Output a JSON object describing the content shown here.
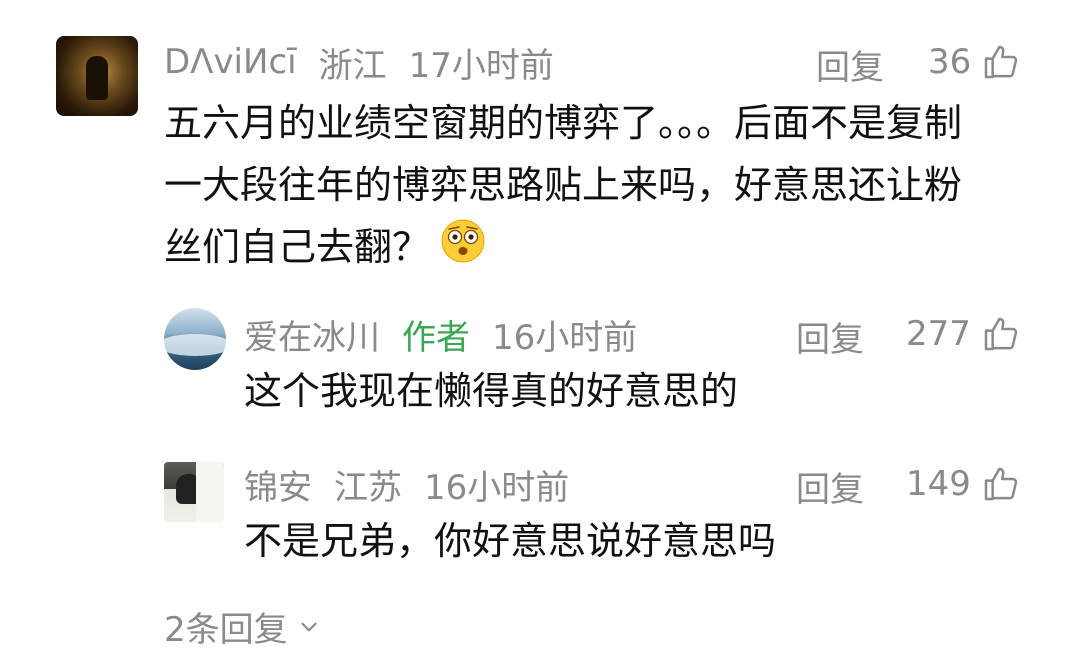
{
  "main_comment": {
    "username": "DΛviИcī",
    "location": "浙江",
    "time": "17小时前",
    "reply_label": "回复",
    "likes": "36",
    "lines": [
      "五六月的业绩空窗期的博弈了。。。后面不是复制",
      "一大段往年的博弈思路贴上来吗，好意思还让粉",
      "丝们自己去翻？"
    ],
    "emoji": "astonished-face-emoji"
  },
  "replies": [
    {
      "username": "爱在冰川",
      "tag": "作者",
      "time": "16小时前",
      "reply_label": "回复",
      "likes": "277",
      "text": "这个我现在懒得真的好意思的"
    },
    {
      "username": "锦安",
      "location": "江苏",
      "time": "16小时前",
      "reply_label": "回复",
      "likes": "149",
      "text": "不是兄弟，你好意思说好意思吗"
    }
  ],
  "more_replies": "2条回复",
  "colors": {
    "meta_gray": "#8a8a8a",
    "author_green": "#3aa655",
    "text": "#111111"
  }
}
